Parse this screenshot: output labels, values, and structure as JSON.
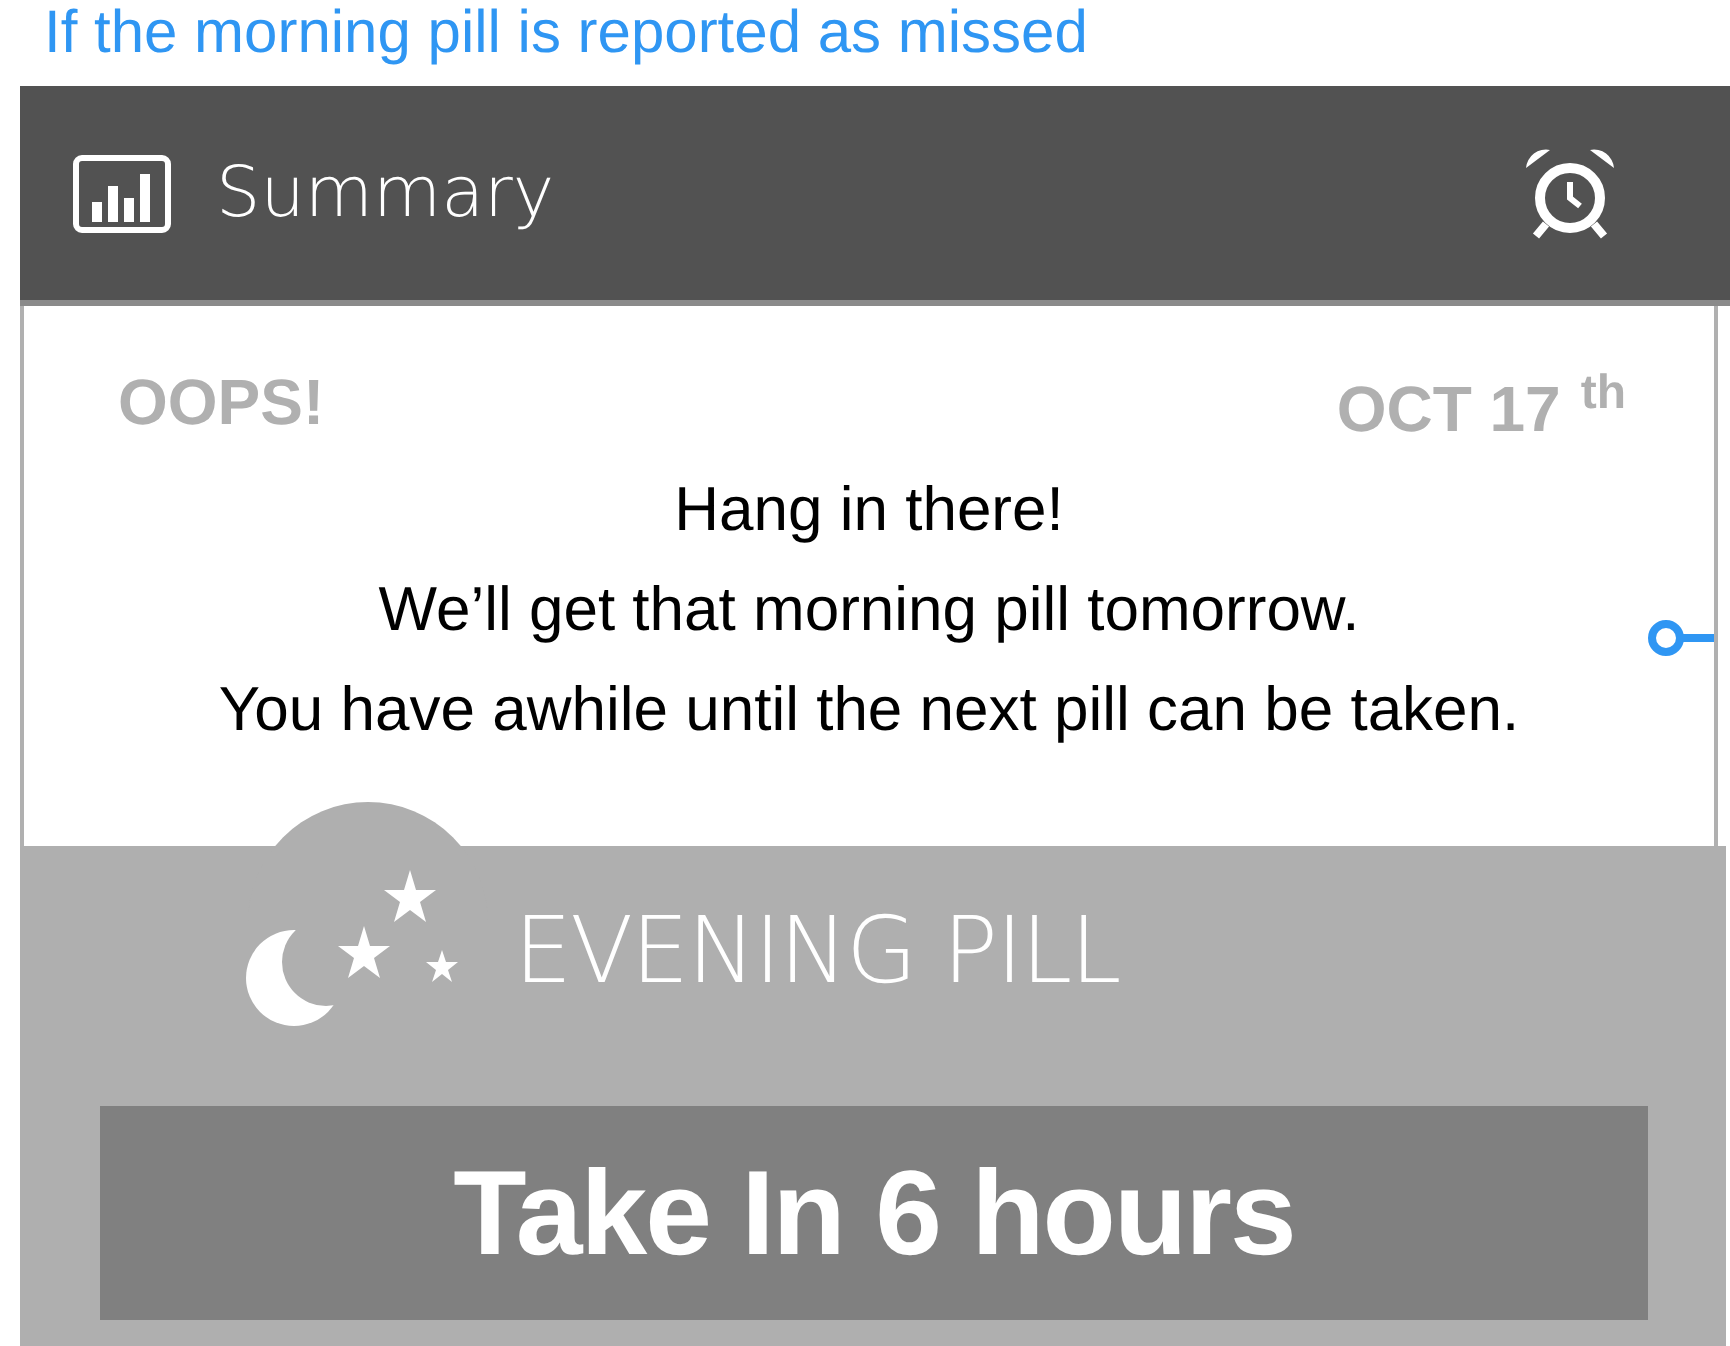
{
  "caption": "If the morning pill is reported as missed",
  "header": {
    "title": "Summary"
  },
  "card": {
    "status": "OOPS!",
    "date": "OCT 17",
    "date_suffix": "th",
    "lines": [
      "Hang in there!",
      "We’ll get that morning pill tomorrow.",
      "You have awhile until the next pill can be taken."
    ]
  },
  "pill": {
    "title": "EVENING PILL",
    "action": "Take In 6 hours"
  }
}
